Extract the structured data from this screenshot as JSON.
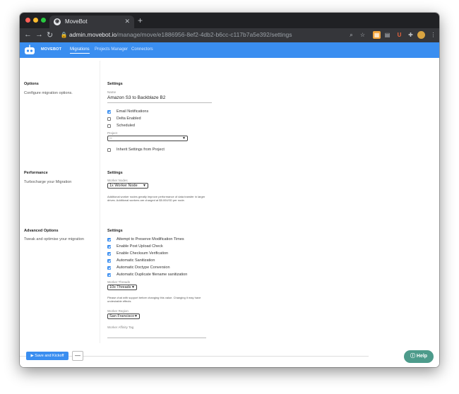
{
  "browser": {
    "tab_title": "MoveBot",
    "url_host": "admin.movebot.io",
    "url_path": "/manage/move/e1886956-8ef2-4db2-b6cc-c117b7a5e392/settings"
  },
  "app": {
    "logo_text": "MOVEBOT",
    "nav": [
      "Migrations",
      "Projects Manager",
      "Connectors"
    ]
  },
  "sections": {
    "options": {
      "title": "Options",
      "subtitle": "Configure migration options.",
      "settings_title": "Settings",
      "name_label": "Name",
      "name_value": "Amazon S3 to Backblaze B2",
      "checkboxes": [
        {
          "label": "Email Notifications",
          "checked": true
        },
        {
          "label": "Delta Enabled",
          "checked": false
        },
        {
          "label": "Scheduled",
          "checked": false
        }
      ],
      "project_label": "Project",
      "project_value": "--",
      "inherit_label": "Inherit Settings from Project",
      "inherit_checked": false
    },
    "performance": {
      "title": "Performance",
      "subtitle": "Turbocharge your Migration",
      "settings_title": "Settings",
      "worker_nodes_label": "Worker Nodes",
      "worker_nodes_value": "1x Worker Node",
      "help": "Additional worker nodes greatly improve performance of data transfer in larger drives. Additional workers are charged at $5.00USD per node."
    },
    "advanced": {
      "title": "Advanced Options",
      "subtitle": "Tweak and optimise your migration",
      "settings_title": "Settings",
      "checkboxes": [
        {
          "label": "Attempt to Preserve Modification Times",
          "checked": true
        },
        {
          "label": "Enable Post Upload Check",
          "checked": true
        },
        {
          "label": "Enable Checksum Verification",
          "checked": true
        },
        {
          "label": "Automatic Sanitization",
          "checked": true
        },
        {
          "label": "Automatic Doctype Conversion",
          "checked": true
        },
        {
          "label": "Automatic Duplicate filename sanitization",
          "checked": true
        }
      ],
      "worker_threads_label": "Worker Threads",
      "worker_threads_value": "10x Threads",
      "threads_help": "Please chat with support before changing this value. Changing it may have undesirable effects",
      "worker_region_label": "Worker Region",
      "worker_region_value": "San Francisco",
      "affinity_label": "Worker Affinity Tag",
      "affinity_value": ""
    }
  },
  "footer": {
    "save_label": "▶ Save and Kickoff",
    "more_label": "—",
    "help_label": "Help"
  },
  "colors": {
    "primary": "#3a8ef0",
    "help": "#4d9b8b"
  }
}
